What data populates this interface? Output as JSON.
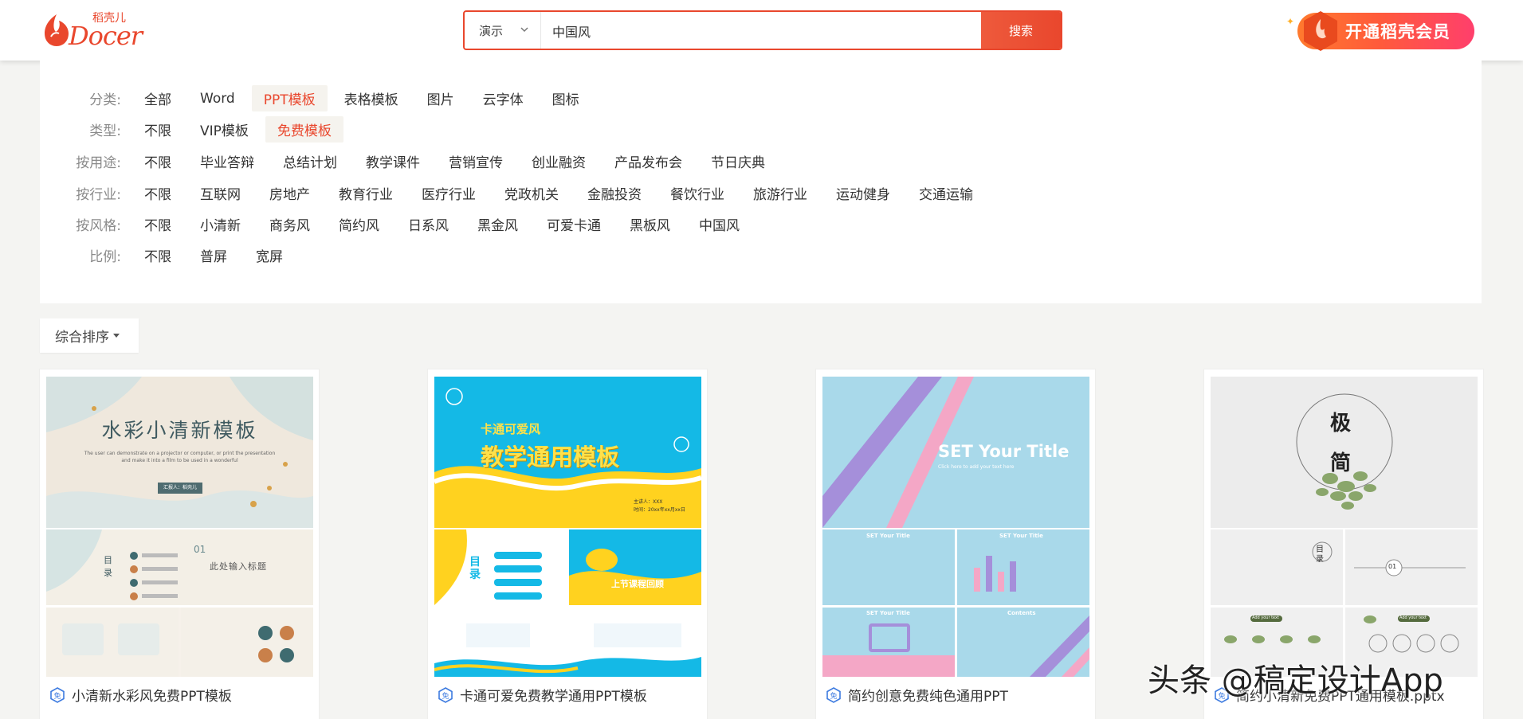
{
  "header": {
    "logo_text": "Docer",
    "logo_sub": "稻壳儿",
    "search_type": "演示",
    "search_value": "中国风",
    "search_button": "搜索",
    "vip_button": "开通稻壳会员"
  },
  "filters": {
    "rows": [
      {
        "label": "分类:",
        "options": [
          "全部",
          "Word",
          "PPT模板",
          "表格模板",
          "图片",
          "云字体",
          "图标"
        ],
        "active": 2
      },
      {
        "label": "类型:",
        "options": [
          "不限",
          "VIP模板",
          "免费模板"
        ],
        "active": 2
      },
      {
        "label": "按用途:",
        "options": [
          "不限",
          "毕业答辩",
          "总结计划",
          "教学课件",
          "营销宣传",
          "创业融资",
          "产品发布会",
          "节日庆典"
        ],
        "active": -1
      },
      {
        "label": "按行业:",
        "options": [
          "不限",
          "互联网",
          "房地产",
          "教育行业",
          "医疗行业",
          "党政机关",
          "金融投资",
          "餐饮行业",
          "旅游行业",
          "运动健身",
          "交通运输"
        ],
        "active": -1
      },
      {
        "label": "按风格:",
        "options": [
          "不限",
          "小清新",
          "商务风",
          "简约风",
          "日系风",
          "黑金风",
          "可爱卡通",
          "黑板风",
          "中国风"
        ],
        "active": -1
      },
      {
        "label": "比例:",
        "options": [
          "不限",
          "普屏",
          "宽屏"
        ],
        "active": -1
      }
    ]
  },
  "sort": {
    "label": "综合排序"
  },
  "cards": [
    {
      "title": "小清新水彩风免费PPT模板",
      "thumb_title": "水彩小清新模板",
      "thumb_sub1": "The user can demonstrate on a projector or computer, or print the presentation",
      "thumb_sub2": "and make it into a film to be used in a wonderful",
      "thumb_badge": "汇报人：稻壳儿",
      "s2_left": "目录",
      "s2_num": "01",
      "s2_right": "此处输入标题"
    },
    {
      "title": "卡通可爱免费教学通用PPT模板",
      "thumb_small": "卡通可爱风",
      "thumb_big": "教学通用模板",
      "thumb_meta1": "主讲人：XXX",
      "thumb_meta2": "时间：20xx年xx月xx日",
      "s2_left": "目录",
      "s2_right": "上节课程回顾"
    },
    {
      "title": "简约创意免费纯色通用PPT",
      "thumb_title": "SET Your Title",
      "thumb_sub": "Click here to add your text here",
      "s_title": "SET Your Title",
      "s_contents": "Contents"
    },
    {
      "title": "简约小清新免费PPT通用模板.pptx",
      "thumb_c1": "极",
      "thumb_c2": "简",
      "s_mulu": "目录",
      "s_01": "01",
      "s_tag": "Add your text"
    }
  ],
  "watermark": "头条 @稿定设计App",
  "colors": {
    "accent": "#e9472d",
    "bg": "#f4f4f2",
    "free_icon": "#3d7be0"
  }
}
